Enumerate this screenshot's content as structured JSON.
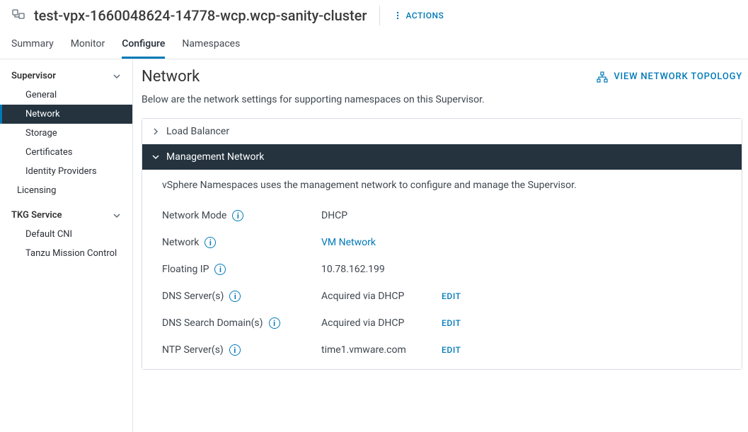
{
  "header": {
    "title": "test-vpx-1660048624-14778-wcp.wcp-sanity-cluster",
    "actions_label": "ACTIONS"
  },
  "tabs": [
    "Summary",
    "Monitor",
    "Configure",
    "Namespaces"
  ],
  "tabs_active": "Configure",
  "sidebar": {
    "groups": [
      {
        "label": "Supervisor",
        "items": [
          "General",
          "Network",
          "Storage",
          "Certificates",
          "Identity Providers"
        ]
      }
    ],
    "top_item": "Licensing",
    "tkg": {
      "label": "TKG Service",
      "items": [
        "Default CNI",
        "Tanzu Mission Control"
      ]
    }
  },
  "page": {
    "title": "Network",
    "topology_label": "VIEW NETWORK TOPOLOGY",
    "description": "Below are the network settings for supporting namespaces on this Supervisor."
  },
  "accordion": {
    "collapsed_title": "Load Balancer",
    "expanded_title": "Management Network",
    "subdescription": "vSphere Namespaces uses the management network to configure and manage the Supervisor.",
    "edit_label": "EDIT",
    "fields": [
      {
        "label": "Network Mode",
        "value": "DHCP",
        "info": true,
        "link": false,
        "edit": false
      },
      {
        "label": "Network",
        "value": "VM Network",
        "info": true,
        "link": true,
        "edit": false
      },
      {
        "label": "Floating IP",
        "value": "10.78.162.199",
        "info": true,
        "link": false,
        "edit": false
      },
      {
        "label": "DNS Server(s)",
        "value": "Acquired via DHCP",
        "info": true,
        "link": false,
        "edit": true
      },
      {
        "label": "DNS Search Domain(s)",
        "value": "Acquired via DHCP",
        "info": true,
        "link": false,
        "edit": true
      },
      {
        "label": "NTP Server(s)",
        "value": "time1.vmware.com",
        "info": true,
        "link": false,
        "edit": true
      }
    ]
  }
}
